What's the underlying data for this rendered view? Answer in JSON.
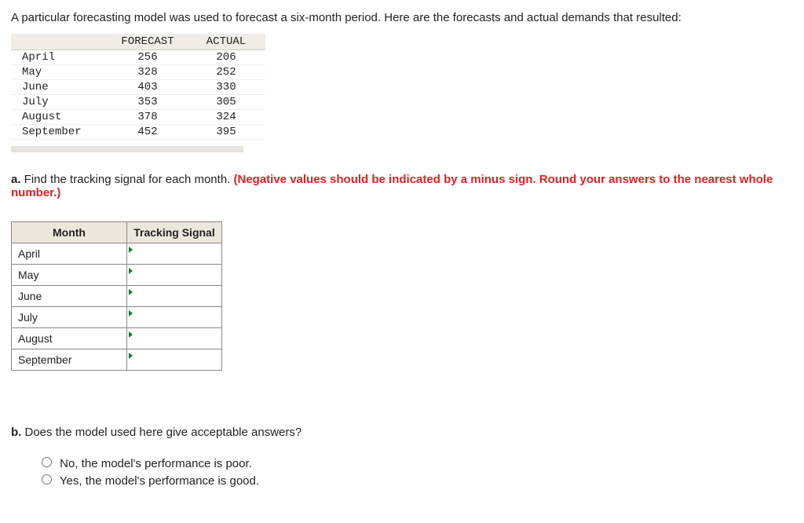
{
  "intro": "A particular forecasting model was used to forecast a six-month period. Here are the forecasts and actual demands that resulted:",
  "data_table": {
    "headers": {
      "forecast": "FORECAST",
      "actual": "ACTUAL"
    },
    "rows": [
      {
        "month": "April",
        "forecast": "256",
        "actual": "206"
      },
      {
        "month": "May",
        "forecast": "328",
        "actual": "252"
      },
      {
        "month": "June",
        "forecast": "403",
        "actual": "330"
      },
      {
        "month": "July",
        "forecast": "353",
        "actual": "305"
      },
      {
        "month": "August",
        "forecast": "378",
        "actual": "324"
      },
      {
        "month": "September",
        "forecast": "452",
        "actual": "395"
      }
    ]
  },
  "part_a": {
    "label": "a.",
    "text": " Find the tracking signal for each month. ",
    "red": "(Negative values should be indicated by a minus sign. Round your answers to the nearest whole number.)",
    "headers": {
      "month": "Month",
      "ts": "Tracking Signal"
    },
    "months": [
      "April",
      "May",
      "June",
      "July",
      "August",
      "September"
    ]
  },
  "part_b": {
    "label": "b.",
    "text": " Does the model used here give acceptable answers?",
    "options": [
      "No, the model's performance is poor.",
      "Yes, the model's performance is good."
    ]
  },
  "chart_data": {
    "type": "table",
    "columns": [
      "Month",
      "Forecast",
      "Actual"
    ],
    "rows": [
      [
        "April",
        256,
        206
      ],
      [
        "May",
        328,
        252
      ],
      [
        "June",
        403,
        330
      ],
      [
        "July",
        353,
        305
      ],
      [
        "August",
        378,
        324
      ],
      [
        "September",
        452,
        395
      ]
    ]
  }
}
